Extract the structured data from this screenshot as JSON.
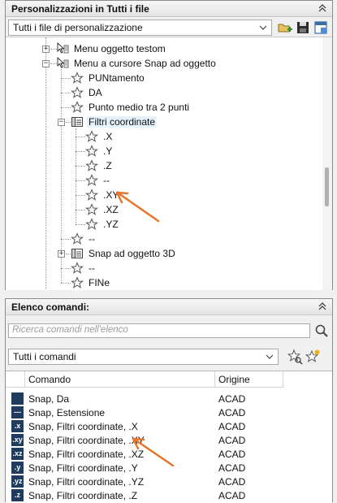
{
  "top_panel": {
    "title": "Personalizzazioni in Tutti i file",
    "file_selector": "Tutti i file di personalizzazione"
  },
  "tree": {
    "items": [
      {
        "label": "Menu oggetto testom",
        "icon": "shortcut-menu-icon"
      },
      {
        "label": "Menu a cursore Snap ad oggetto",
        "icon": "shortcut-menu-icon"
      },
      {
        "label": "PUNtamento",
        "icon": "star-icon"
      },
      {
        "label": "DA",
        "icon": "star-icon"
      },
      {
        "label": "Punto medio tra 2 punti",
        "icon": "star-icon"
      },
      {
        "label": "Filtri coordinate",
        "icon": "submenu-icon"
      },
      {
        "label": ".X",
        "icon": "star-icon"
      },
      {
        "label": ".Y",
        "icon": "star-icon"
      },
      {
        "label": ".Z",
        "icon": "star-icon"
      },
      {
        "label": "--",
        "icon": "star-icon"
      },
      {
        "label": ".XY",
        "icon": "star-icon"
      },
      {
        "label": ".XZ",
        "icon": "star-icon"
      },
      {
        "label": ".YZ",
        "icon": "star-icon"
      },
      {
        "label": "--",
        "icon": "star-icon"
      },
      {
        "label": "Snap ad oggetto 3D",
        "icon": "submenu-icon"
      },
      {
        "label": "--",
        "icon": "star-icon"
      },
      {
        "label": "FINe",
        "icon": "star-icon"
      }
    ]
  },
  "bottom_panel": {
    "title": "Elenco comandi:",
    "search_placeholder": "Ricerca comandi nell'elenco",
    "filter_selector": "Tutti i comandi",
    "columns": {
      "command": "Comando",
      "origin": "Origine"
    },
    "rows": [
      {
        "name": "Snap, Da",
        "origin": "ACAD",
        "icon_text": ""
      },
      {
        "name": "Snap, Estensione",
        "origin": "ACAD",
        "icon_text": "---"
      },
      {
        "name": "Snap, Filtri coordinate, .X",
        "origin": "ACAD",
        "icon_text": ".x"
      },
      {
        "name": "Snap, Filtri coordinate, .XY",
        "origin": "ACAD",
        "icon_text": ".xy"
      },
      {
        "name": "Snap, Filtri coordinate, .XZ",
        "origin": "ACAD",
        "icon_text": ".xz"
      },
      {
        "name": "Snap, Filtri coordinate, .Y",
        "origin": "ACAD",
        "icon_text": ".y"
      },
      {
        "name": "Snap, Filtri coordinate, .YZ",
        "origin": "ACAD",
        "icon_text": ".yz"
      },
      {
        "name": "Snap, Filtri coordinate, .Z",
        "origin": "ACAD",
        "icon_text": ".z"
      }
    ]
  },
  "colors": {
    "annotation_arrow": "#e8742a",
    "selection": "#e5f1fb",
    "command_icon": "#1f3b5e"
  }
}
